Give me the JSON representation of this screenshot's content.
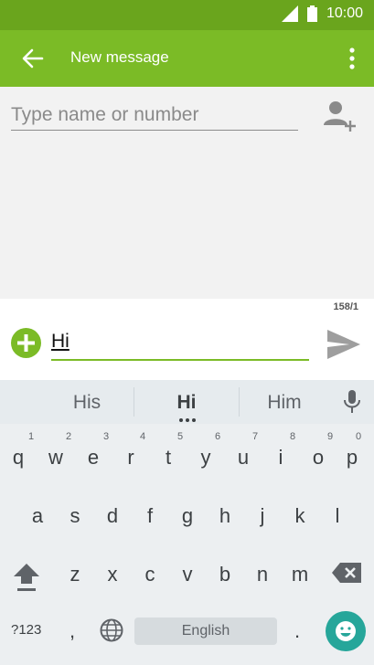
{
  "status": {
    "time": "10:00"
  },
  "app_bar": {
    "title": "New message"
  },
  "recipient": {
    "placeholder": "Type name or number"
  },
  "compose": {
    "char_count": "158/1",
    "message_text": "Hi"
  },
  "suggestions": {
    "left": "His",
    "center": "Hi",
    "right": "Him"
  },
  "keyboard": {
    "row1": [
      {
        "key": "q",
        "hint": "1"
      },
      {
        "key": "w",
        "hint": "2"
      },
      {
        "key": "e",
        "hint": "3"
      },
      {
        "key": "r",
        "hint": "4"
      },
      {
        "key": "t",
        "hint": "5"
      },
      {
        "key": "y",
        "hint": "6"
      },
      {
        "key": "u",
        "hint": "7"
      },
      {
        "key": "i",
        "hint": "8"
      },
      {
        "key": "o",
        "hint": "9"
      },
      {
        "key": "p",
        "hint": "0"
      }
    ],
    "row2": [
      "a",
      "s",
      "d",
      "f",
      "g",
      "h",
      "j",
      "k",
      "l"
    ],
    "row3": [
      "z",
      "x",
      "c",
      "v",
      "b",
      "n",
      "m"
    ],
    "symbols_label": "?123",
    "comma": ",",
    "space_label": "English",
    "period": "."
  },
  "colors": {
    "status_bar": "#6aa51d",
    "app_bar": "#7bbb26",
    "accent": "#7bbb26",
    "emoji": "#26a69a"
  }
}
